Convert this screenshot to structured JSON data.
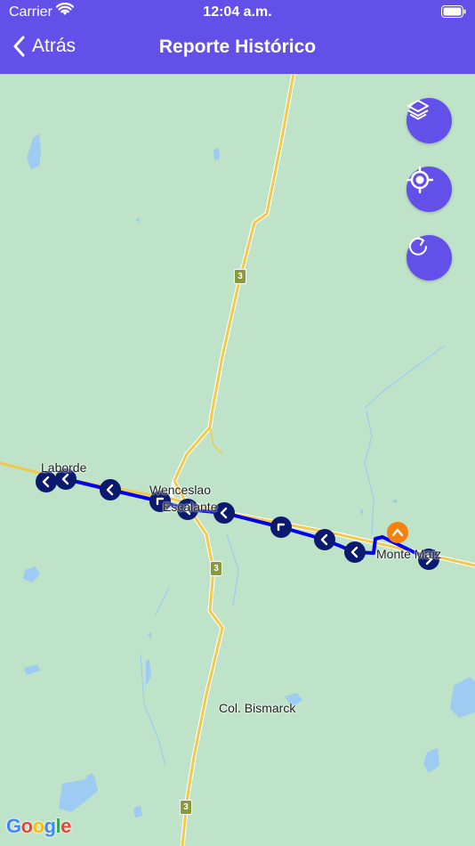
{
  "status_bar": {
    "carrier": "Carrier",
    "time": "12:04 a.m."
  },
  "nav": {
    "back_label": "Atrás",
    "title": "Reporte Histórico"
  },
  "map": {
    "places": [
      "Laborde",
      "Wenceslao",
      "Escalante",
      "Monte Maíz",
      "Col. Bismarck"
    ],
    "route_shields": [
      "3",
      "3",
      "3"
    ],
    "attribution": "Google"
  },
  "controls": [
    {
      "name": "layers-button",
      "icon": "layers-icon"
    },
    {
      "name": "my-location-button",
      "icon": "crosshair-icon"
    },
    {
      "name": "refresh-button",
      "icon": "refresh-icon"
    }
  ],
  "colors": {
    "brand": "#6250e8",
    "route_line": "#0000ee",
    "route_marker": "#0b1a6e",
    "current_marker": "#f5820f",
    "road": "#f2c94c",
    "land": "#bfe3c9",
    "water": "#9ecbf2"
  }
}
